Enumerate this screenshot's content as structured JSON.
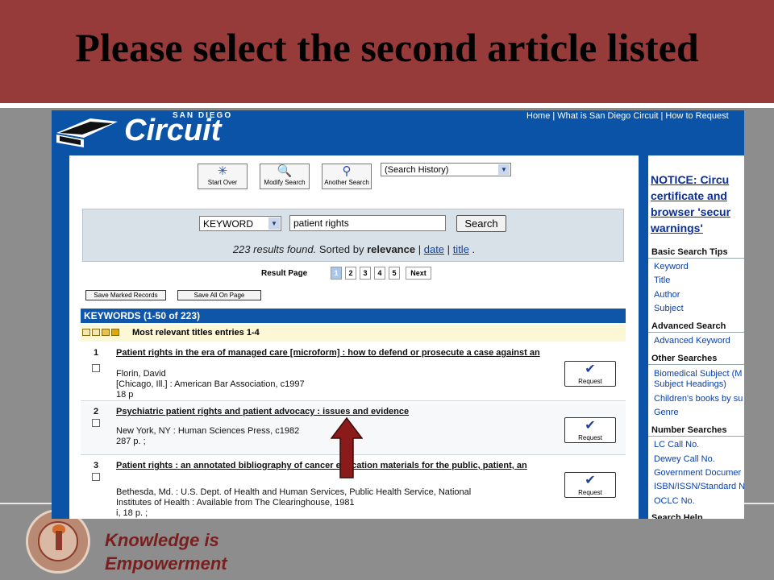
{
  "slide": {
    "title": "Please select the second article listed",
    "tagline_1": "Knowledge is",
    "tagline_2": "Empowerment"
  },
  "site": {
    "logo_small": "SAN DIEGO",
    "logo_big": "Circuit",
    "toplinks": [
      "Home",
      "What is San Diego Circuit",
      "How to Request"
    ]
  },
  "toolbar": {
    "start_over": "Start Over",
    "modify_search": "Modify Search",
    "another_search": "Another Search",
    "history_select": "(Search History)"
  },
  "search": {
    "type_select": "KEYWORD",
    "query": "patient rights",
    "button": "Search",
    "results_text": "223 results found.",
    "sorted_text": "Sorted by",
    "sort_current": "relevance",
    "sort_bar": "|",
    "sort_date": "date",
    "sort_bar2": "|",
    "sort_title": "title",
    "sort_end": "."
  },
  "pager": {
    "label": "Result Page",
    "pages": [
      "1",
      "2",
      "3",
      "4",
      "5"
    ],
    "next": "Next"
  },
  "actions": {
    "save_marked": "Save Marked Records",
    "save_all": "Save All On Page"
  },
  "results": {
    "header": "KEYWORDS (1-50 of 223)",
    "relevance_heading": "Most relevant titles entries 1-4",
    "request_label": "Request",
    "entries": [
      {
        "num": "1",
        "title": "Patient rights in the era of managed care [microform] : how to defend or prosecute a case against an",
        "lines": [
          "Florin, David",
          "[Chicago, Ill.] : American Bar Association, c1997",
          "18 p"
        ]
      },
      {
        "num": "2",
        "title": "Psychiatric patient rights and patient advocacy : issues and evidence",
        "lines": [
          "New York, NY : Human Sciences Press, c1982",
          "287 p. ;"
        ]
      },
      {
        "num": "3",
        "title": "Patient rights : an annotated bibliography of cancer education materials for the public, patient, an",
        "lines": [
          "Bethesda, Md. : U.S. Dept. of Health and Human Services, Public Health Service, National",
          "Institutes of Health : Available from The Clearinghouse, 1981",
          "i, 18 p. ;"
        ]
      }
    ]
  },
  "sidebar": {
    "notice": [
      "NOTICE: Circu",
      "certificate and",
      "browser 'secur",
      "warnings'"
    ],
    "basic_head": "Basic Search Tips",
    "basic_items": [
      "Keyword",
      "Title",
      "Author",
      "Subject"
    ],
    "advanced_head": "Advanced Search",
    "advanced_items": [
      "Advanced Keyword"
    ],
    "other_head": "Other Searches",
    "other_items": [
      "Biomedical Subject (M",
      "Subject Headings)",
      "Children's books by su",
      "Genre"
    ],
    "number_head": "Number Searches",
    "number_items": [
      "LC Call No.",
      "Dewey Call No.",
      "Government Documer",
      "ISBN/ISSN/Standard N",
      "OCLC No."
    ],
    "help_head": "Search Help"
  },
  "colors": {
    "header_red": "#963a3a",
    "site_blue": "#0a53a7",
    "pointer_arrow": "#8b1a1a"
  }
}
